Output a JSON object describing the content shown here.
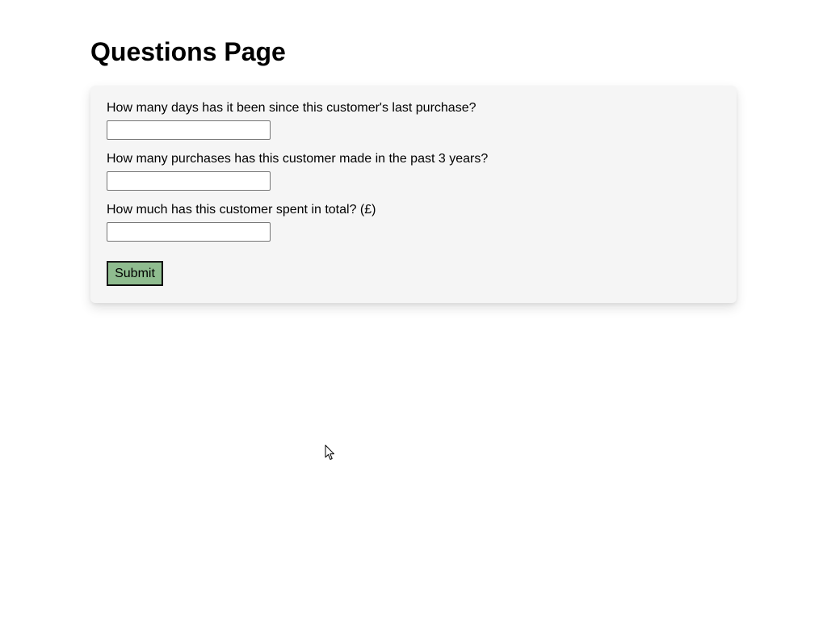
{
  "page": {
    "title": "Questions Page"
  },
  "form": {
    "questions": [
      {
        "label": "How many days has it been since this customer's last purchase?",
        "value": "",
        "placeholder": ""
      },
      {
        "label": "How many purchases has this customer made in the past 3 years?",
        "value": "",
        "placeholder": ""
      },
      {
        "label": "How much has this customer spent in total? (£)",
        "value": "",
        "placeholder": ""
      }
    ],
    "submit_label": "Submit"
  },
  "colors": {
    "card_background": "#f5f5f5",
    "submit_background": "#8fbc8f"
  },
  "icons": {
    "cursor": "mouse-pointer-icon"
  }
}
